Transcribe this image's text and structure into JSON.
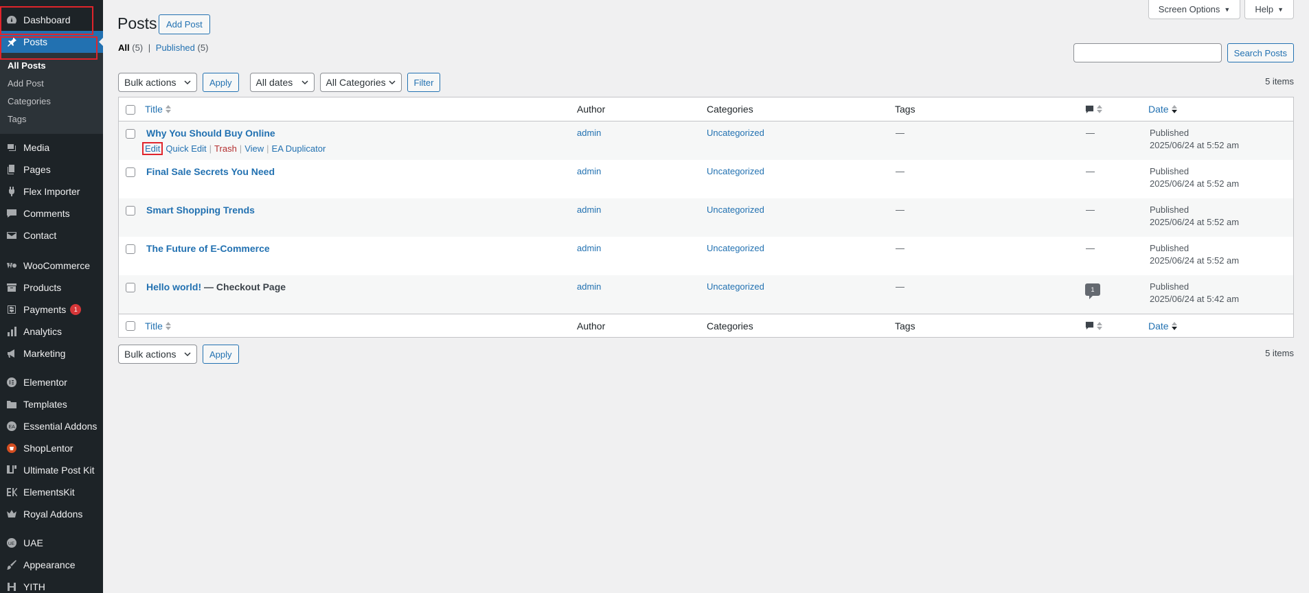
{
  "sidebar": {
    "items": [
      {
        "key": "dashboard",
        "label": "Dashboard",
        "icon": "dashboard-icon"
      },
      {
        "key": "posts",
        "label": "Posts",
        "icon": "pin-icon",
        "current": true
      },
      {
        "key": "media",
        "label": "Media",
        "icon": "media-icon"
      },
      {
        "key": "pages",
        "label": "Pages",
        "icon": "pages-icon"
      },
      {
        "key": "flex-importer",
        "label": "Flex Importer",
        "icon": "plug-icon"
      },
      {
        "key": "comments",
        "label": "Comments",
        "icon": "comment-icon"
      },
      {
        "key": "contact",
        "label": "Contact",
        "icon": "mail-icon"
      },
      {
        "key": "woocommerce",
        "label": "WooCommerce",
        "icon": "woo-icon"
      },
      {
        "key": "products",
        "label": "Products",
        "icon": "archive-icon"
      },
      {
        "key": "payments",
        "label": "Payments",
        "icon": "dollar-icon",
        "badge": "1"
      },
      {
        "key": "analytics",
        "label": "Analytics",
        "icon": "bar-chart-icon"
      },
      {
        "key": "marketing",
        "label": "Marketing",
        "icon": "megaphone-icon"
      },
      {
        "key": "elementor",
        "label": "Elementor",
        "icon": "elementor-icon"
      },
      {
        "key": "templates",
        "label": "Templates",
        "icon": "folder-icon"
      },
      {
        "key": "essential-addons",
        "label": "Essential Addons",
        "icon": "ea-icon"
      },
      {
        "key": "shoplentor",
        "label": "ShopLentor",
        "icon": "shoplentor-icon"
      },
      {
        "key": "ultimate-post-kit",
        "label": "Ultimate Post Kit",
        "icon": "upk-icon"
      },
      {
        "key": "elementskit",
        "label": "ElementsKit",
        "icon": "ek-icon"
      },
      {
        "key": "royal-addons",
        "label": "Royal Addons",
        "icon": "crown-icon"
      },
      {
        "key": "uae",
        "label": "UAE",
        "icon": "uae-icon"
      },
      {
        "key": "appearance",
        "label": "Appearance",
        "icon": "brush-icon"
      },
      {
        "key": "yith",
        "label": "YITH",
        "icon": "yith-icon"
      }
    ],
    "posts_submenu": [
      "All Posts",
      "Add Post",
      "Categories",
      "Tags"
    ]
  },
  "header": {
    "screen_options": "Screen Options",
    "help": "Help",
    "title": "Posts",
    "add_post": "Add Post"
  },
  "views": {
    "all_label": "All",
    "all_count": "(5)",
    "separator": "|",
    "published_label": "Published",
    "published_count": "(5)"
  },
  "search": {
    "value": "",
    "button": "Search Posts"
  },
  "tablenav_top": {
    "bulk_actions": "Bulk actions",
    "apply": "Apply",
    "dates": "All dates",
    "categories": "All Categories",
    "filter": "Filter",
    "items": "5 items"
  },
  "tablenav_bottom": {
    "bulk_actions": "Bulk actions",
    "apply": "Apply",
    "items": "5 items"
  },
  "table": {
    "columns": {
      "title": "Title",
      "author": "Author",
      "categories": "Categories",
      "tags": "Tags",
      "date": "Date"
    },
    "row_actions": {
      "edit": "Edit",
      "quick_edit": "Quick Edit",
      "trash": "Trash",
      "view": "View",
      "duplicator": "EA Duplicator",
      "sep": "|"
    },
    "rows": [
      {
        "title": "Why You Should Buy Online",
        "state": "",
        "author": "admin",
        "category": "Uncategorized",
        "tags": "—",
        "comments": "—",
        "status": "Published",
        "date": "2025/06/24 at 5:52 am"
      },
      {
        "title": "Final Sale Secrets You Need",
        "state": "",
        "author": "admin",
        "category": "Uncategorized",
        "tags": "—",
        "comments": "—",
        "status": "Published",
        "date": "2025/06/24 at 5:52 am"
      },
      {
        "title": "Smart Shopping Trends",
        "state": "",
        "author": "admin",
        "category": "Uncategorized",
        "tags": "—",
        "comments": "—",
        "status": "Published",
        "date": "2025/06/24 at 5:52 am"
      },
      {
        "title": "The Future of E-Commerce",
        "state": "",
        "author": "admin",
        "category": "Uncategorized",
        "tags": "—",
        "comments": "—",
        "status": "Published",
        "date": "2025/06/24 at 5:52 am"
      },
      {
        "title": "Hello world!",
        "state": " — Checkout Page",
        "author": "admin",
        "category": "Uncategorized",
        "tags": "—",
        "comments": "1",
        "status": "Published",
        "date": "2025/06/24 at 5:42 am"
      }
    ]
  }
}
